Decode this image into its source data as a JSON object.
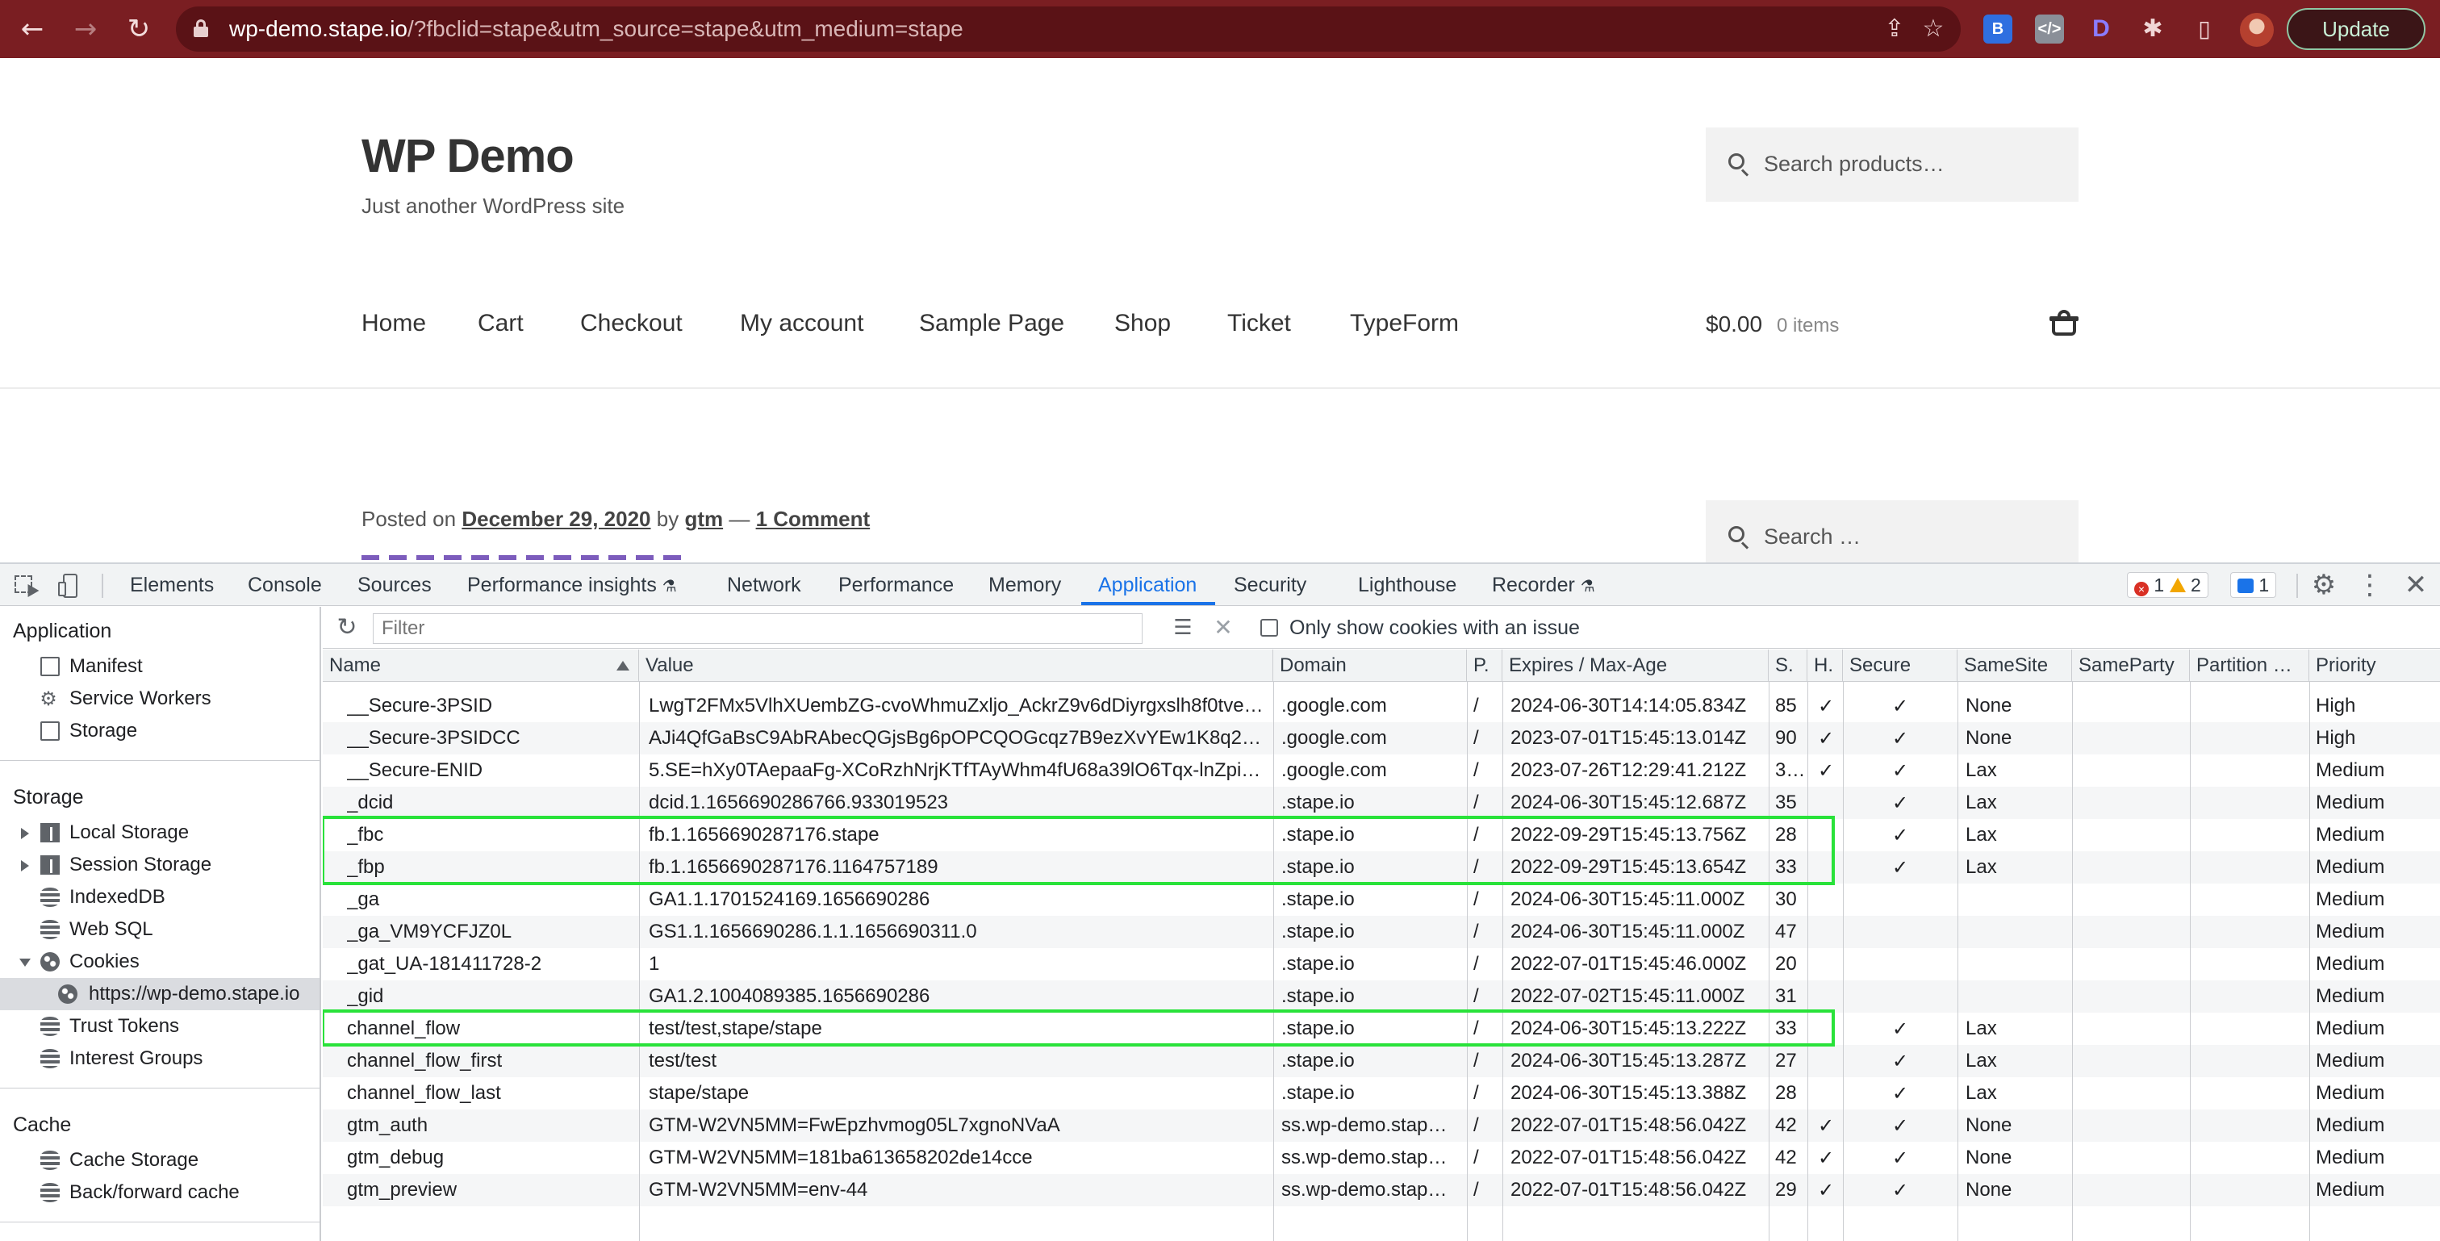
{
  "browser": {
    "url_host": "wp-demo.stape.io",
    "url_rest": "/?fbclid=stape&utm_source=stape&utm_medium=stape",
    "update_label": "Update"
  },
  "site": {
    "title": "WP Demo",
    "tagline": "Just another WordPress site",
    "search_products_placeholder": "Search products…",
    "search_placeholder": "Search …",
    "nav": [
      "Home",
      "Cart",
      "Checkout",
      "My account",
      "Sample Page",
      "Shop",
      "Ticket",
      "TypeForm"
    ],
    "cart_total": "$0.00",
    "cart_items": "0 items",
    "posted_on": "Posted on",
    "post_date": "December 29, 2020",
    "by": "by",
    "author": "gtm",
    "dash": "—",
    "comments": "1 Comment"
  },
  "devtools": {
    "tabs": [
      "Elements",
      "Console",
      "Sources",
      "Performance insights",
      "Network",
      "Performance",
      "Memory",
      "Application",
      "Security",
      "Lighthouse",
      "Recorder"
    ],
    "active_tab": "Application",
    "errors": "1",
    "warnings": "2",
    "messages": "1",
    "sidebar": {
      "application_header": "Application",
      "application_items": [
        "Manifest",
        "Service Workers",
        "Storage"
      ],
      "storage_header": "Storage",
      "storage_items": [
        "Local Storage",
        "Session Storage",
        "IndexedDB",
        "Web SQL",
        "Cookies",
        "https://wp-demo.stape.io",
        "Trust Tokens",
        "Interest Groups"
      ],
      "cache_header": "Cache",
      "cache_items": [
        "Cache Storage",
        "Back/forward cache"
      ]
    },
    "cookies_toolbar": {
      "filter_placeholder": "Filter",
      "issue_checkbox_label": "Only show cookies with an issue"
    },
    "columns": [
      "Name",
      "Value",
      "Domain",
      "P.",
      "Expires / Max-Age",
      "S.",
      "H.",
      "Secure",
      "SameSite",
      "SameParty",
      "Partition …",
      "Priority"
    ],
    "cookies": [
      {
        "name": "__Secure-3PSID",
        "value": "LwgT2FMx5VlhXUembZG-cvoWhmuZxljo_AckrZ9v6dDiyrgxslh8f0tve…",
        "domain": ".google.com",
        "path": "/",
        "expires": "2024-06-30T14:14:05.834Z",
        "size": "85",
        "httponly": "✓",
        "secure": "✓",
        "samesite": "None",
        "priority": "High"
      },
      {
        "name": "__Secure-3PSIDCC",
        "value": "AJi4QfGaBsC9AbRAbecQGjsBg6pOPCQOGcqz7B9ezXvYEw1K8q2…",
        "domain": ".google.com",
        "path": "/",
        "expires": "2023-07-01T15:45:13.014Z",
        "size": "90",
        "httponly": "✓",
        "secure": "✓",
        "samesite": "None",
        "priority": "High"
      },
      {
        "name": "__Secure-ENID",
        "value": "5.SE=hXy0TAepaaFg-XCoRzhNrjKTfTAyWhm4fU68a39lO6Tqx-lnZpi…",
        "domain": ".google.com",
        "path": "/",
        "expires": "2023-07-26T12:29:41.212Z",
        "size": "3…",
        "httponly": "✓",
        "secure": "✓",
        "samesite": "Lax",
        "priority": "Medium"
      },
      {
        "name": "_dcid",
        "value": "dcid.1.1656690286766.933019523",
        "domain": ".stape.io",
        "path": "/",
        "expires": "2024-06-30T15:45:12.687Z",
        "size": "35",
        "httponly": "",
        "secure": "✓",
        "samesite": "Lax",
        "priority": "Medium"
      },
      {
        "name": "_fbc",
        "value": "fb.1.1656690287176.stape",
        "domain": ".stape.io",
        "path": "/",
        "expires": "2022-09-29T15:45:13.756Z",
        "size": "28",
        "httponly": "",
        "secure": "✓",
        "samesite": "Lax",
        "priority": "Medium"
      },
      {
        "name": "_fbp",
        "value": "fb.1.1656690287176.1164757189",
        "domain": ".stape.io",
        "path": "/",
        "expires": "2022-09-29T15:45:13.654Z",
        "size": "33",
        "httponly": "",
        "secure": "✓",
        "samesite": "Lax",
        "priority": "Medium"
      },
      {
        "name": "_ga",
        "value": "GA1.1.1701524169.1656690286",
        "domain": ".stape.io",
        "path": "/",
        "expires": "2024-06-30T15:45:11.000Z",
        "size": "30",
        "httponly": "",
        "secure": "",
        "samesite": "",
        "priority": "Medium"
      },
      {
        "name": "_ga_VM9YCFJZ0L",
        "value": "GS1.1.1656690286.1.1.1656690311.0",
        "domain": ".stape.io",
        "path": "/",
        "expires": "2024-06-30T15:45:11.000Z",
        "size": "47",
        "httponly": "",
        "secure": "",
        "samesite": "",
        "priority": "Medium"
      },
      {
        "name": "_gat_UA-181411728-2",
        "value": "1",
        "domain": ".stape.io",
        "path": "/",
        "expires": "2022-07-01T15:45:46.000Z",
        "size": "20",
        "httponly": "",
        "secure": "",
        "samesite": "",
        "priority": "Medium"
      },
      {
        "name": "_gid",
        "value": "GA1.2.1004089385.1656690286",
        "domain": ".stape.io",
        "path": "/",
        "expires": "2022-07-02T15:45:11.000Z",
        "size": "31",
        "httponly": "",
        "secure": "",
        "samesite": "",
        "priority": "Medium"
      },
      {
        "name": "channel_flow",
        "value": "test/test,stape/stape",
        "domain": ".stape.io",
        "path": "/",
        "expires": "2024-06-30T15:45:13.222Z",
        "size": "33",
        "httponly": "",
        "secure": "✓",
        "samesite": "Lax",
        "priority": "Medium"
      },
      {
        "name": "channel_flow_first",
        "value": "test/test",
        "domain": ".stape.io",
        "path": "/",
        "expires": "2024-06-30T15:45:13.287Z",
        "size": "27",
        "httponly": "",
        "secure": "✓",
        "samesite": "Lax",
        "priority": "Medium"
      },
      {
        "name": "channel_flow_last",
        "value": "stape/stape",
        "domain": ".stape.io",
        "path": "/",
        "expires": "2024-06-30T15:45:13.388Z",
        "size": "28",
        "httponly": "",
        "secure": "✓",
        "samesite": "Lax",
        "priority": "Medium"
      },
      {
        "name": "gtm_auth",
        "value": "GTM-W2VN5MM=FwEpzhvmog05L7xgnoNVaA",
        "domain": "ss.wp-demo.stap…",
        "path": "/",
        "expires": "2022-07-01T15:48:56.042Z",
        "size": "42",
        "httponly": "✓",
        "secure": "✓",
        "samesite": "None",
        "priority": "Medium"
      },
      {
        "name": "gtm_debug",
        "value": "GTM-W2VN5MM=181ba613658202de14cce",
        "domain": "ss.wp-demo.stap…",
        "path": "/",
        "expires": "2022-07-01T15:48:56.042Z",
        "size": "42",
        "httponly": "✓",
        "secure": "✓",
        "samesite": "None",
        "priority": "Medium"
      },
      {
        "name": "gtm_preview",
        "value": "GTM-W2VN5MM=env-44",
        "domain": "ss.wp-demo.stap…",
        "path": "/",
        "expires": "2022-07-01T15:48:56.042Z",
        "size": "29",
        "httponly": "✓",
        "secure": "✓",
        "samesite": "None",
        "priority": "Medium"
      }
    ],
    "highlight_color": "#29e23a"
  }
}
